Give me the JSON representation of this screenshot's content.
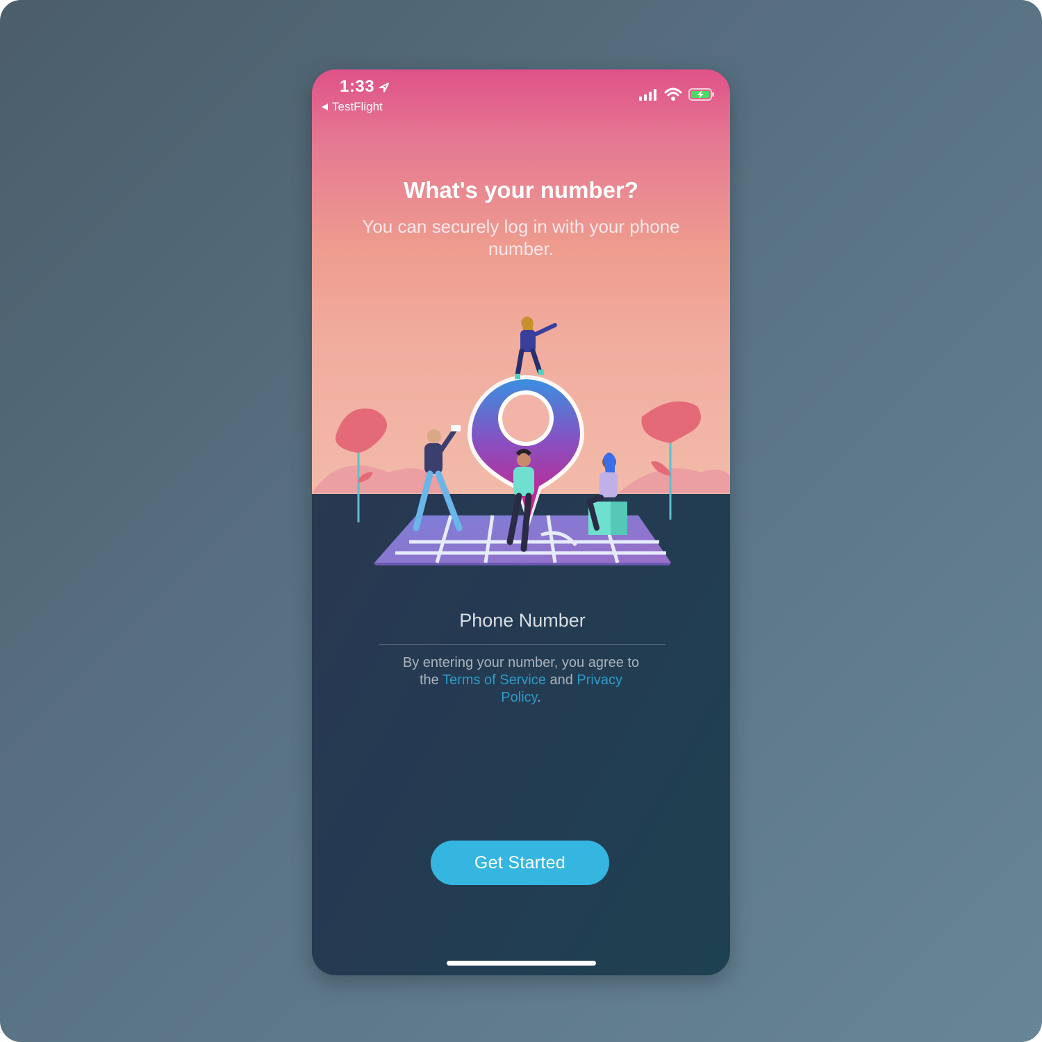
{
  "status_bar": {
    "time": "1:33",
    "back_app": "TestFlight",
    "icons": [
      "location-arrow-icon",
      "cellular-signal-icon",
      "wifi-icon",
      "battery-charging-icon"
    ]
  },
  "onboarding": {
    "title": "What's your number?",
    "subtitle": "You can securely log in with your phone number.",
    "phone_label": "Phone Number",
    "agreement": {
      "prefix": "By entering your number, you agree to the ",
      "terms_link": "Terms of Service",
      "middle": " and ",
      "privacy_link": "Privacy Policy",
      "suffix": "."
    },
    "cta_label": "Get Started"
  },
  "colors": {
    "sky_top": "#df5288",
    "sky_bottom": "#f2baa9",
    "ground": "#253a52",
    "link": "#2f9ac6",
    "button": "#35b6e0"
  }
}
